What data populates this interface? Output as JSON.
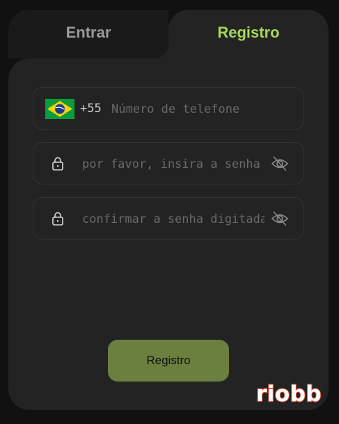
{
  "tabs": {
    "login_label": "Entrar",
    "register_label": "Registro"
  },
  "phone": {
    "country_code": "+55",
    "placeholder": "Número de telefone",
    "flag": "brazil-flag"
  },
  "password": {
    "placeholder": "por favor, insira a senha",
    "icon": "lock-icon",
    "toggle_icon": "eye-off-icon"
  },
  "confirm_password": {
    "placeholder": "confirmar a senha digitada",
    "icon": "lock-icon",
    "toggle_icon": "eye-off-icon"
  },
  "submit": {
    "label": "Registro"
  },
  "brand": {
    "logo_text": "riobb"
  },
  "colors": {
    "accent": "#a6d65b",
    "button": "#6b7f3e",
    "logo_stroke": "#e4553c"
  }
}
